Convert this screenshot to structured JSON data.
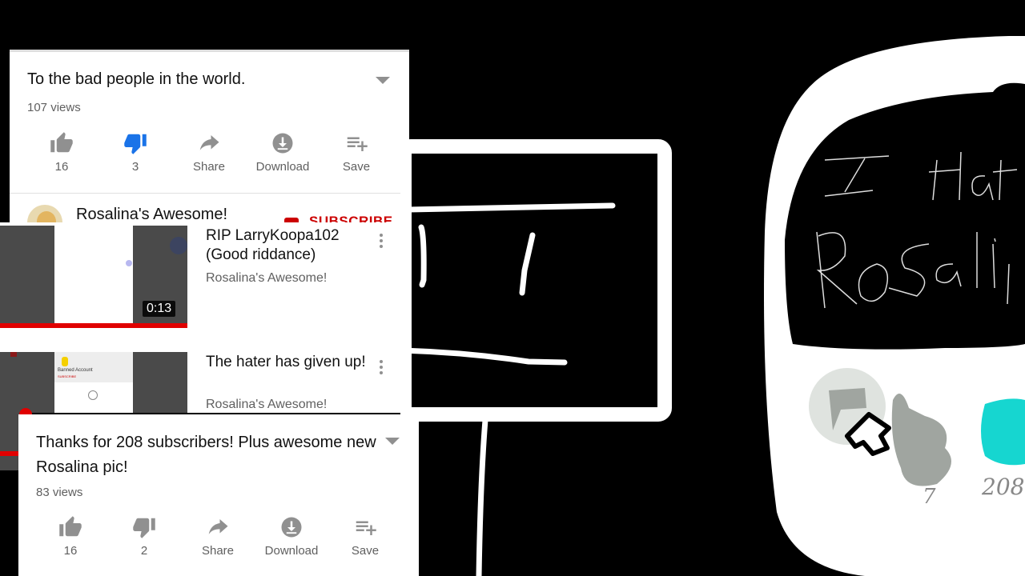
{
  "card1": {
    "title": "To the bad people in the world.",
    "views": "107 views",
    "actions": [
      {
        "icon": "thumbs-up-icon",
        "label": "16"
      },
      {
        "icon": "thumbs-down-icon",
        "label": "3",
        "active": true
      },
      {
        "icon": "share-icon",
        "label": "Share"
      },
      {
        "icon": "download-icon",
        "label": "Download"
      },
      {
        "icon": "save-playlist-icon",
        "label": "Save"
      }
    ],
    "channel": "Rosalina's Awesome!",
    "subscribe": "SUBSCRIBE"
  },
  "related": [
    {
      "title": "RIP LarryKoopa102 (Good riddance)",
      "channel": "Rosalina's Awesome!",
      "duration": "0:13"
    },
    {
      "title": "The hater has given up!",
      "channel": "Rosalina's Awesome!",
      "thumb_text": "Banned Account",
      "thumb_sub": "SUBSCRIBE"
    }
  ],
  "card2": {
    "title": "Thanks for 208 subscribers! Plus awesome new Rosalina pic!",
    "views": "83 views",
    "actions": [
      {
        "icon": "thumbs-up-icon",
        "label": "16"
      },
      {
        "icon": "thumbs-down-icon",
        "label": "2"
      },
      {
        "icon": "share-icon",
        "label": "Share"
      },
      {
        "icon": "download-icon",
        "label": "Download"
      },
      {
        "icon": "save-playlist-icon",
        "label": "Save"
      }
    ]
  },
  "drawing": {
    "handwriting_line1": "I Hat",
    "handwriting_line2": "Rosalin",
    "like_count": "7",
    "count_right": "208"
  },
  "colors": {
    "active_blue": "#1a73e8",
    "icon_gray": "#909090",
    "subscribe_red": "#cc0000",
    "progress_red": "#e00000",
    "cyan": "#16d6d0"
  }
}
